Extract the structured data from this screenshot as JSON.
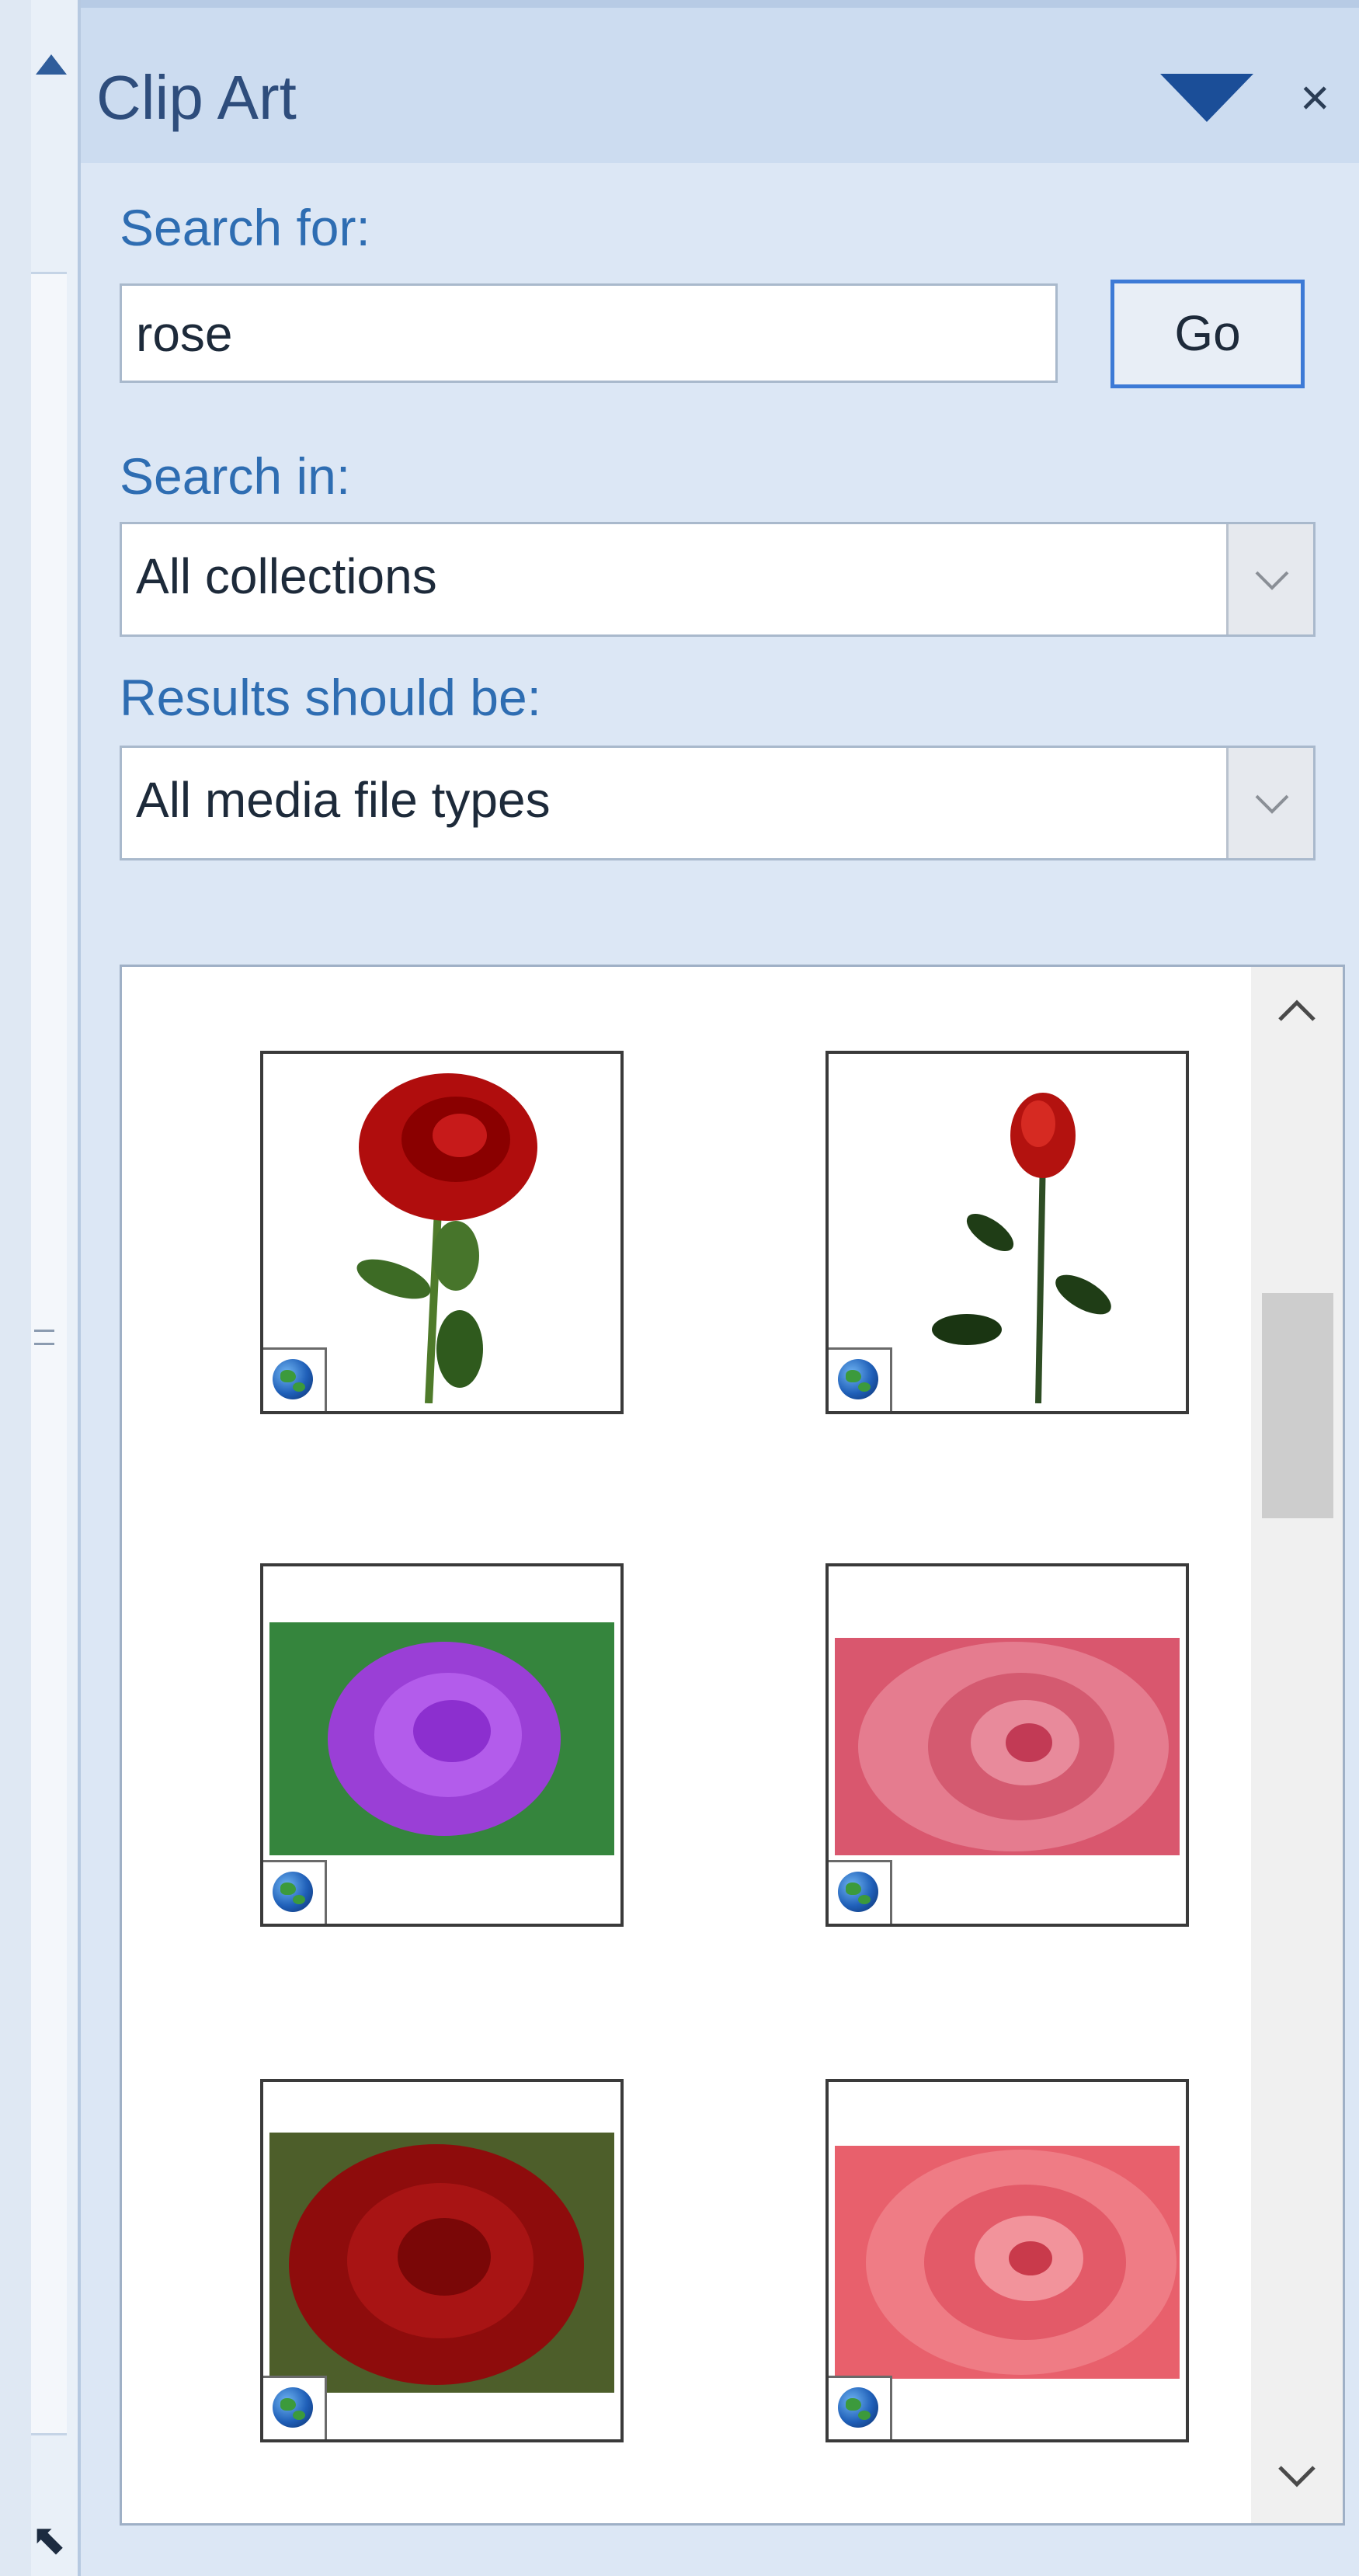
{
  "pane": {
    "title": "Clip Art",
    "search_label": "Search for:",
    "search_value": "rose",
    "go_label": "Go",
    "search_in_label": "Search in:",
    "search_in_value": "All collections",
    "results_label": "Results should be:",
    "results_value": "All media file types"
  },
  "results": {
    "items": [
      {
        "name": "red rose with stem",
        "type": "clip art",
        "badge": "globe-icon"
      },
      {
        "name": "single red rose bud with stem",
        "type": "clip art",
        "badge": "globe-icon"
      },
      {
        "name": "purple rose",
        "type": "photo",
        "badge": "globe-icon"
      },
      {
        "name": "pink rose",
        "type": "photo",
        "badge": "globe-icon"
      },
      {
        "name": "dark red rose",
        "type": "photo",
        "badge": "globe-icon"
      },
      {
        "name": "salmon pink rose",
        "type": "photo",
        "badge": "globe-icon"
      }
    ]
  },
  "colors": {
    "header_bg": "#ccdcf0",
    "pane_bg": "#dce7f5",
    "label_blue": "#2e6db2",
    "title_blue": "#2e4d7c",
    "accent_blue": "#1b4e98",
    "go_border": "#3d7ad6"
  }
}
